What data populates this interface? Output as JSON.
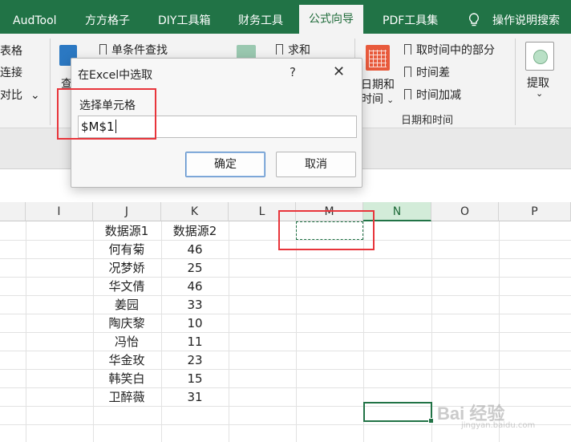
{
  "ribbon_tabs": [
    {
      "label": "AudTool"
    },
    {
      "label": "方方格子"
    },
    {
      "label": "DIY工具箱"
    },
    {
      "label": "财务工具"
    },
    {
      "label": "公式向导"
    },
    {
      "label": "PDF工具集"
    },
    {
      "label": "操作说明搜索"
    }
  ],
  "ribbon": {
    "left_partial_items": [
      "表格",
      "连接",
      "对比"
    ],
    "left_partial_dropdown": "⌄",
    "lookup_item": "单条件查找",
    "partial_label": "查",
    "sum_item": "求和",
    "date_items": [
      "取时间中的部分",
      "时间差",
      "时间加减"
    ],
    "date_button_line1": "日期和",
    "date_button_line2": "时间",
    "date_group_label": "日期和时间",
    "extract_button": "提取",
    "dropdown_glyph": "⌄",
    "accent_color": "#217346"
  },
  "dialog": {
    "title": "在Excel中选取",
    "help": "?",
    "close": "✕",
    "label": "选择单元格",
    "input_value": "$M$1",
    "ok_label": "确定",
    "cancel_label": "取消"
  },
  "grid": {
    "columns": [
      "I",
      "J",
      "K",
      "L",
      "M",
      "N",
      "O",
      "P"
    ],
    "selected_column": "N",
    "header_row": [
      "数据源1",
      "数据源2"
    ],
    "rows": [
      [
        "何有菊",
        "46"
      ],
      [
        "况梦娇",
        "25"
      ],
      [
        "华文倩",
        "46"
      ],
      [
        "姜园",
        "33"
      ],
      [
        "陶庆黎",
        "10"
      ],
      [
        "冯怡",
        "11"
      ],
      [
        "华金玫",
        "23"
      ],
      [
        "韩笑白",
        "15"
      ],
      [
        "卫醉薇",
        "31"
      ]
    ]
  },
  "watermark": {
    "main": "Bai 经验",
    "sub": "jingyan.baidu.com"
  }
}
